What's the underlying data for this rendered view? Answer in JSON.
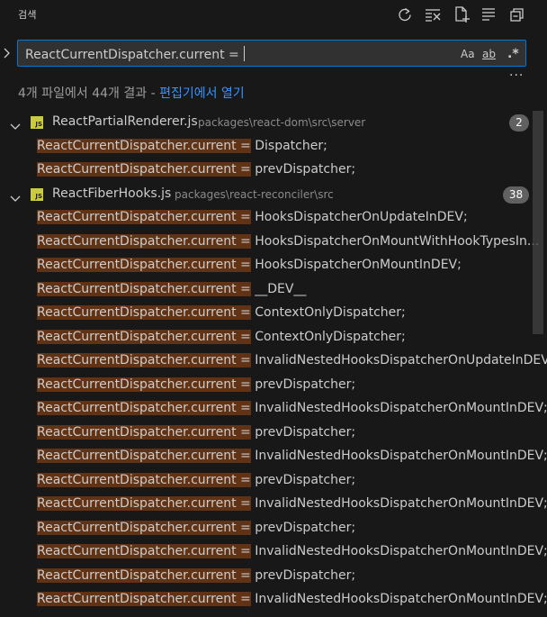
{
  "header": {
    "title": "검색",
    "icons": [
      "refresh-icon",
      "clear-results-icon",
      "new-search-editor-icon",
      "view-as-tree-icon",
      "collapse-all-icon"
    ]
  },
  "search": {
    "value": "ReactCurrentDispatcher.current = ",
    "options": {
      "match_case": "Aa",
      "whole_word": "ab",
      "regex": ".*"
    }
  },
  "summary": {
    "text": "4개 파일에서 44개 결과",
    "separator": " - ",
    "link": "편집기에서 열기"
  },
  "files": [
    {
      "name": "ReactPartialRenderer.js",
      "path": "packages\\react-dom\\src\\server",
      "count": "2",
      "matches": [
        {
          "match": "ReactCurrentDispatcher.current =",
          "rest": " Dispatcher;"
        },
        {
          "match": "ReactCurrentDispatcher.current =",
          "rest": " prevDispatcher;"
        }
      ]
    },
    {
      "name": "ReactFiberHooks.js",
      "path": "packages\\react-reconciler\\src",
      "count": "38",
      "matches": [
        {
          "match": "ReactCurrentDispatcher.current =",
          "rest": " HooksDispatcherOnUpdateInDEV;"
        },
        {
          "match": "ReactCurrentDispatcher.current =",
          "rest": " HooksDispatcherOnMountWithHookTypesIn..."
        },
        {
          "match": "ReactCurrentDispatcher.current =",
          "rest": " HooksDispatcherOnMountInDEV;"
        },
        {
          "match": "ReactCurrentDispatcher.current =",
          "rest": " __DEV__"
        },
        {
          "match": "ReactCurrentDispatcher.current =",
          "rest": " ContextOnlyDispatcher;"
        },
        {
          "match": "ReactCurrentDispatcher.current =",
          "rest": " ContextOnlyDispatcher;"
        },
        {
          "match": "ReactCurrentDispatcher.current =",
          "rest": " InvalidNestedHooksDispatcherOnUpdateInDEV;"
        },
        {
          "match": "ReactCurrentDispatcher.current =",
          "rest": " prevDispatcher;"
        },
        {
          "match": "ReactCurrentDispatcher.current =",
          "rest": " InvalidNestedHooksDispatcherOnMountInDEV;"
        },
        {
          "match": "ReactCurrentDispatcher.current =",
          "rest": " prevDispatcher;"
        },
        {
          "match": "ReactCurrentDispatcher.current =",
          "rest": " InvalidNestedHooksDispatcherOnMountInDEV;"
        },
        {
          "match": "ReactCurrentDispatcher.current =",
          "rest": " prevDispatcher;"
        },
        {
          "match": "ReactCurrentDispatcher.current =",
          "rest": " InvalidNestedHooksDispatcherOnMountInDEV;"
        },
        {
          "match": "ReactCurrentDispatcher.current =",
          "rest": " prevDispatcher;"
        },
        {
          "match": "ReactCurrentDispatcher.current =",
          "rest": " InvalidNestedHooksDispatcherOnMountInDEV;"
        },
        {
          "match": "ReactCurrentDispatcher.current =",
          "rest": " prevDispatcher;"
        },
        {
          "match": "ReactCurrentDispatcher.current =",
          "rest": " InvalidNestedHooksDispatcherOnMountInDEV;"
        }
      ]
    }
  ],
  "colors": {
    "background": "#181818",
    "focus_border": "#0078d4",
    "match_highlight": "#613214",
    "link": "#3794ff",
    "badge": "#616161",
    "js_icon": "#cbcb41"
  }
}
